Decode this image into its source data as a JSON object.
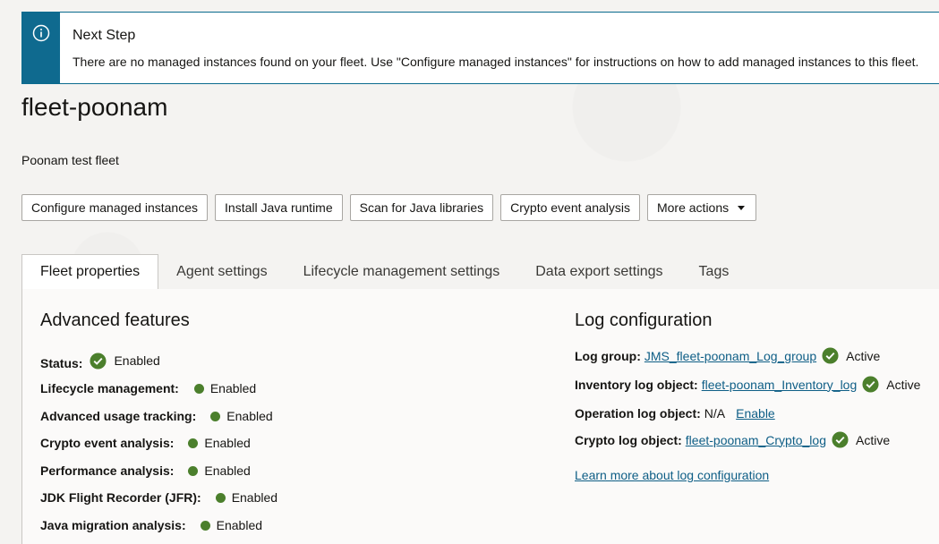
{
  "notice": {
    "title": "Next Step",
    "text": "There are no managed instances found on your fleet. Use \"Configure managed instances\" for instructions on how to add managed instances to this fleet."
  },
  "page": {
    "title": "fleet-poonam",
    "description": "Poonam test fleet"
  },
  "actions": {
    "configure": "Configure managed instances",
    "install_java": "Install Java runtime",
    "scan_libraries": "Scan for Java libraries",
    "crypto_analysis": "Crypto event analysis",
    "more_actions": "More actions"
  },
  "tabs": [
    "Fleet properties",
    "Agent settings",
    "Lifecycle management settings",
    "Data export settings",
    "Tags"
  ],
  "advanced": {
    "title": "Advanced features",
    "items": [
      {
        "label": "Status:",
        "value": "Enabled"
      },
      {
        "label": "Lifecycle management:",
        "value": "Enabled"
      },
      {
        "label": "Advanced usage tracking:",
        "value": "Enabled"
      },
      {
        "label": "Crypto event analysis:",
        "value": "Enabled"
      },
      {
        "label": "Performance analysis:",
        "value": "Enabled"
      },
      {
        "label": "JDK Flight Recorder (JFR):",
        "value": "Enabled"
      },
      {
        "label": "Java migration analysis:",
        "value": "Enabled"
      }
    ]
  },
  "log": {
    "title": "Log configuration",
    "log_group_label": "Log group:",
    "log_group_link": "JMS_fleet-poonam_Log_group",
    "log_group_status": "Active",
    "inventory_label": "Inventory log object:",
    "inventory_link": "fleet-poonam_Inventory_log",
    "inventory_status": "Active",
    "operation_label": "Operation log object:",
    "operation_value": "N/A",
    "operation_link": "Enable",
    "crypto_label": "Crypto log object:",
    "crypto_link": "fleet-poonam_Crypto_log",
    "crypto_status": "Active",
    "learn_more": "Learn more about log configuration"
  },
  "colors": {
    "accent": "#0f6a8f",
    "success": "#4b7f2c",
    "link": "#0e5e86"
  }
}
